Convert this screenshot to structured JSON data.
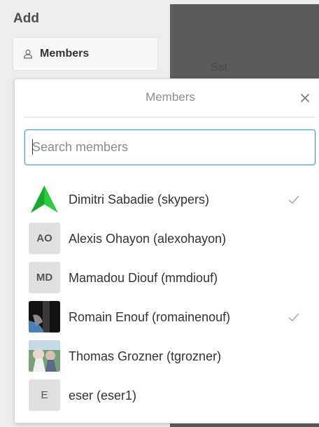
{
  "sidebar": {
    "heading": "Add",
    "members_button_label": "Members",
    "members_button_icon": "person-icon"
  },
  "calendar": {
    "day_label": "Sat"
  },
  "popover": {
    "title": "Members",
    "close_icon": "close-icon",
    "search": {
      "placeholder": "Search members",
      "value": ""
    },
    "members": [
      {
        "name": "Dimitri Sabadie (skypers)",
        "initials": "",
        "avatar": "green-arrow-logo",
        "selected": true
      },
      {
        "name": "Alexis Ohayon (alexohayon)",
        "initials": "AO",
        "avatar": "initials",
        "selected": false
      },
      {
        "name": "Mamadou Diouf (mmdiouf)",
        "initials": "MD",
        "avatar": "initials",
        "selected": false
      },
      {
        "name": "Romain Enouf (romainenouf)",
        "initials": "",
        "avatar": "photo-dark",
        "selected": true
      },
      {
        "name": "Thomas Grozner (tgrozner)",
        "initials": "",
        "avatar": "photo-anime",
        "selected": false
      },
      {
        "name": "eser (eser1)",
        "initials": "E",
        "avatar": "initials",
        "selected": false
      }
    ]
  },
  "colors": {
    "accent": "#4a9fd8",
    "avatar_bg": "#e0e0e0",
    "check": "#a8a8a8"
  }
}
